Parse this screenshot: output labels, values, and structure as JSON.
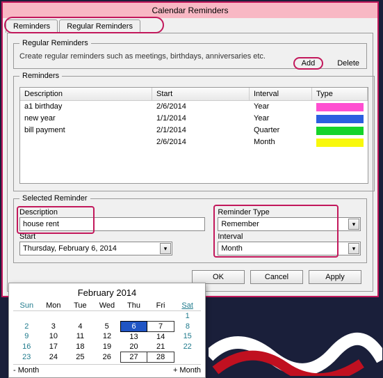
{
  "title": "Calendar Reminders",
  "tabs": {
    "t1": "Reminders",
    "t2": "Regular Reminders"
  },
  "regular": {
    "legend": "Regular Reminders",
    "hint": "Create regular reminders such as meetings, birthdays, anniversaries etc.",
    "add": "Add",
    "delete": "Delete"
  },
  "list": {
    "legend": "Reminders",
    "headers": {
      "desc": "Description",
      "start": "Start",
      "interval": "Interval",
      "type": "Type"
    },
    "rows": [
      {
        "desc": "a1 birthday",
        "start": "2/6/2014",
        "interval": "Year",
        "color": "#ff4fd1"
      },
      {
        "desc": "new year",
        "start": "1/1/2014",
        "interval": "Year",
        "color": "#2b5fe0"
      },
      {
        "desc": "bill payment",
        "start": "2/1/2014",
        "interval": "Quarter",
        "color": "#16d42a"
      },
      {
        "desc": "",
        "start": "2/6/2014",
        "interval": "Month",
        "color": "#f8f80c"
      }
    ]
  },
  "selected": {
    "legend": "Selected Reminder",
    "descLabel": "Description",
    "descValue": "house rent",
    "startLabel": "Start",
    "startValue": "Thursday, February 6, 2014",
    "typeLabel": "Reminder Type",
    "typeValue": "Remember",
    "intervalLabel": "Interval",
    "intervalValue": "Month"
  },
  "buttons": {
    "ok": "OK",
    "cancel": "Cancel",
    "apply": "Apply"
  },
  "calendar": {
    "title": "February 2014",
    "days": {
      "sun": "Sun",
      "mon": "Mon",
      "tue": "Tue",
      "wed": "Wed",
      "thu": "Thu",
      "fri": "Fri",
      "sat": "Sat"
    },
    "prev": "- Month",
    "next": "+ Month",
    "weeks": [
      [
        "",
        "",
        "",
        "",
        "",
        "",
        "1"
      ],
      [
        "2",
        "3",
        "4",
        "5",
        "6",
        "7",
        "8"
      ],
      [
        "9",
        "10",
        "11",
        "12",
        "13",
        "14",
        "15"
      ],
      [
        "16",
        "17",
        "18",
        "19",
        "20",
        "21",
        "22"
      ],
      [
        "23",
        "24",
        "25",
        "26",
        "27",
        "28",
        ""
      ]
    ]
  }
}
